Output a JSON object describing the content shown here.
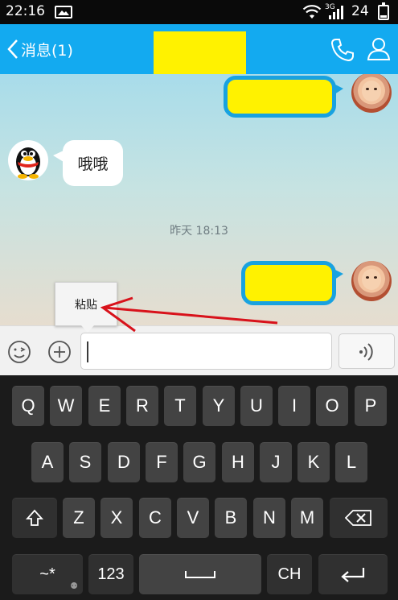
{
  "status_bar": {
    "time": "22:16",
    "network_type": "3G",
    "battery_level": "24"
  },
  "header": {
    "back_label": "消息(1)",
    "contact_name_redacted": true,
    "accent_color": "#13aaf0"
  },
  "chat": {
    "messages": [
      {
        "direction": "outgoing",
        "text_redacted": true
      },
      {
        "direction": "incoming",
        "text": "哦哦"
      },
      {
        "direction": "outgoing",
        "text_redacted": true
      }
    ],
    "timestamp": "昨天 18:13"
  },
  "context_menu": {
    "paste_label": "粘贴"
  },
  "input_bar": {
    "message_value": "",
    "icons": [
      "emoji-icon",
      "plus-icon",
      "voice-icon"
    ]
  },
  "keyboard": {
    "row1": [
      "Q",
      "W",
      "E",
      "R",
      "T",
      "Y",
      "U",
      "I",
      "O",
      "P"
    ],
    "row2": [
      "A",
      "S",
      "D",
      "F",
      "G",
      "H",
      "J",
      "K",
      "L"
    ],
    "row3": [
      "Z",
      "X",
      "C",
      "V",
      "B",
      "N",
      "M"
    ],
    "bottom": {
      "symbols_label": "~*",
      "numbers_label": "123",
      "language_label": "CH"
    }
  }
}
